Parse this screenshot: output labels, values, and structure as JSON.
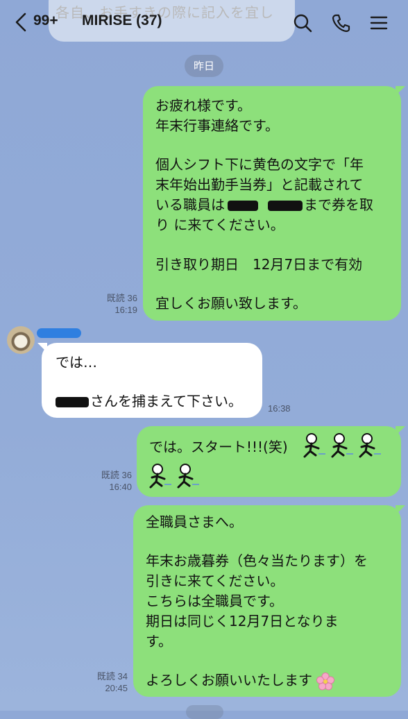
{
  "header": {
    "unread_count": "99+",
    "chat_title": "MIRISE (37)",
    "prev_message_fragment": "各自、お手すきの際に記入を宜し",
    "icons": [
      "back-chevron-icon",
      "search-icon",
      "phone-icon",
      "menu-icon"
    ]
  },
  "date_chip": "昨日",
  "messages": [
    {
      "direction": "outgoing",
      "lines": [
        "お疲れ様です。",
        "年末行事連絡です。",
        "",
        "個人シフト下に黄色の文字で「年",
        "末年始出勤手当券」と記載されて",
        "いる職員は",
        "り に来てください。",
        "",
        "引き取り期日　12月7日まで有効",
        "",
        "宜しくお願い致します。"
      ],
      "line6_after": "まで券を取",
      "read": "既読 36",
      "time": "16:19"
    },
    {
      "direction": "incoming",
      "line1": "では…",
      "line2_after": "さんを捕まえて下さい。",
      "time": "16:38"
    },
    {
      "direction": "outgoing",
      "text": "では。スタート!!!(笑)",
      "read": "既読 36",
      "time": "16:40"
    },
    {
      "direction": "outgoing",
      "lines": [
        "全職員さまへ。",
        "",
        "年末お歳暮券（色々当たります）を",
        "引きに来てください。",
        "こちらは全職員です。",
        "期日は同じく12月7日となりま",
        "す。",
        "",
        "よろしくお願いいたします"
      ],
      "read": "既読 34",
      "time": "20:45"
    }
  ],
  "colors": {
    "background": "#93acd8",
    "outgoing_bubble": "#8de07b",
    "incoming_bubble": "#ffffff"
  }
}
